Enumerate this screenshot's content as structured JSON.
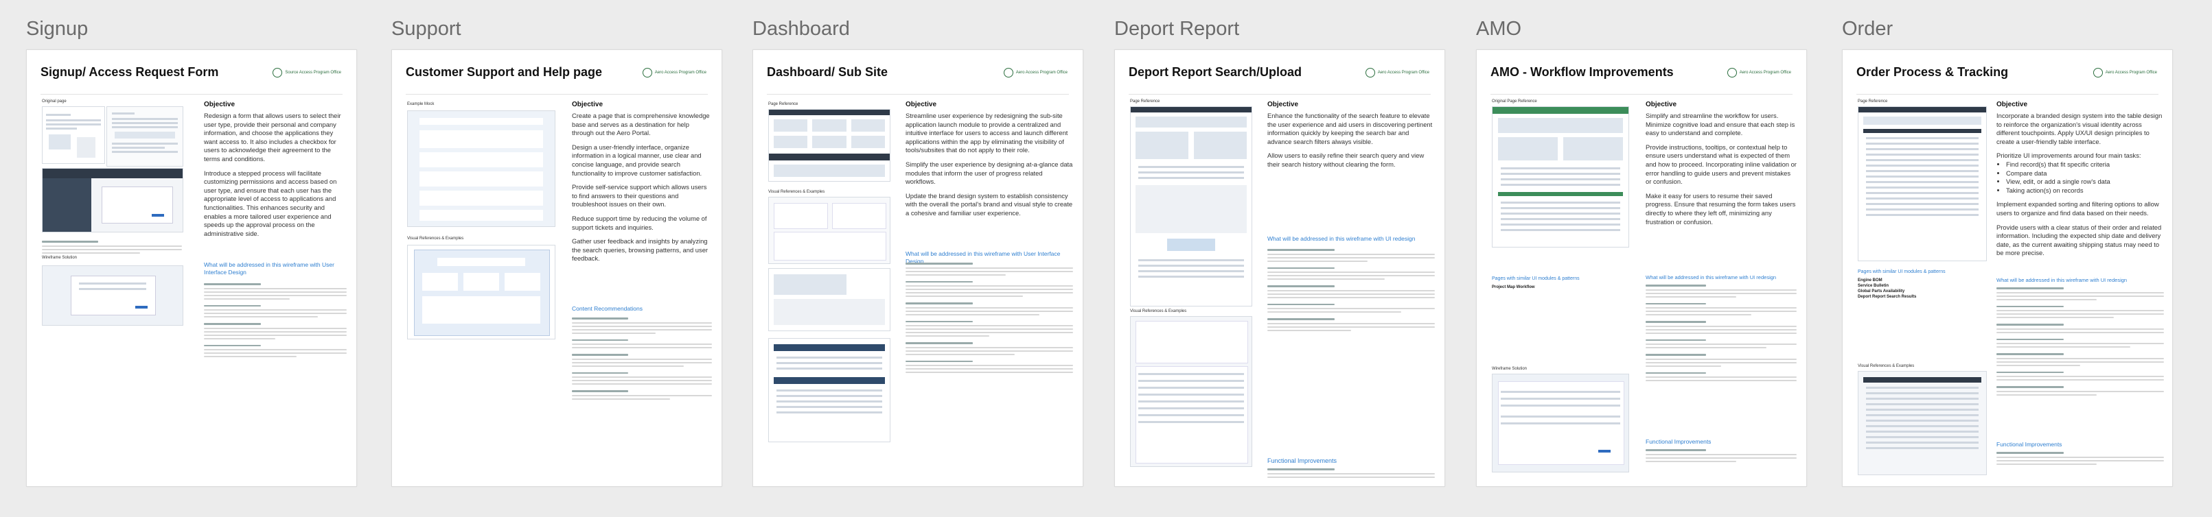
{
  "columns": [
    {
      "label": "Signup",
      "title": "Signup/ Access Request Form",
      "objective_heading": "Objective",
      "objective": [
        "Redesign a form that allows users to select their user type, provide their personal and company information, and choose the applications they want access to. It also includes a checkbox for users to acknowledge their agreement to the terms and conditions.",
        "Introduce a stepped process will facilitate customizing permissions and access based on user type, and ensure that each user has the appropriate level of access to applications and functionalities. This enhances security and enables a more tailored user experience and speeds up the approval process on the administrative side."
      ],
      "addressed_heading": "What will be addressed in this wireframe with User Interface Design",
      "ref_label": "Original page",
      "ref2_label": "Wireframe Solution"
    },
    {
      "label": "Support",
      "title": "Customer Support and Help page",
      "objective_heading": "Objective",
      "objective": [
        "Create a page that is comprehensive knowledge base and serves as a destination for help through out the Aero Portal.",
        "Design a user-friendly interface, organize information in a logical manner, use clear and concise language, and provide search functionality to improve customer satisfaction.",
        "Provide self-service support which allows users to find answers to their questions and troubleshoot issues on their own.",
        "Reduce support time by reducing the volume of support tickets and inquiries.",
        "Gather user feedback and insights by analyzing the search queries, browsing patterns, and user feedback."
      ],
      "addressed_heading": "Content Recommendations",
      "ref_label": "Example Mock",
      "ref2_label": "Visual References & Examples"
    },
    {
      "label": "Dashboard",
      "title": "Dashboard/ Sub Site",
      "objective_heading": "Objective",
      "objective": [
        "Streamline user experience by redesigning the sub-site application launch module to provide a centralized and intuitive interface for users to access and launch different applications within the app by eliminating the visibility of tools/subsites that do not apply to their role.",
        "Simplify the user experience by designing at-a-glance data modules that inform the user of progress related workflows.",
        "Update the brand design system to establish consistency with the overall the portal's brand and visual style to create a cohesive and familiar user experience."
      ],
      "addressed_heading": "What will be addressed in this wireframe with User Interface Design",
      "ref_label": "Page Reference",
      "ref2_label": "Visual References & Examples"
    },
    {
      "label": "Deport Report",
      "title": "Deport Report Search/Upload",
      "objective_heading": "Objective",
      "objective": [
        "Enhance the functionality of the search feature to elevate the user experience and aid users in discovering pertinent information quickly by keeping the search bar and advance search filters always visible.",
        "Allow users to easily refine their search query and view their search history without clearing the form."
      ],
      "addressed_heading": "What will be addressed in this wireframe with UI redesign",
      "extra_heading": "Functional Improvements",
      "ref_label": "Page Reference",
      "ref2_label": "Visual References & Examples"
    },
    {
      "label": "AMO",
      "title": "AMO - Workflow Improvements",
      "objective_heading": "Objective",
      "objective": [
        "Simplify and streamline the workflow for users. Minimize cognitive load and ensure that each step is easy to understand and complete.",
        "Provide instructions, tooltips, or contextual help to ensure users understand what is expected of them and how to proceed. Incorporating inline validation or error handling to guide users and prevent mistakes or confusion.",
        "Make it easy for users to resume their saved progress. Ensure that resuming the form takes users directly to where they left off, minimizing any frustration or confusion."
      ],
      "pages_heading": "Pages with similar UI modules & patterns",
      "pages": [
        "Project Map Workflow"
      ],
      "addressed_heading": "What will be addressed in this wireframe with UI redesign",
      "extra_heading": "Functional Improvements",
      "ref_label": "Original Page Reference",
      "ref2_label": "Wireframe Solution"
    },
    {
      "label": "Order",
      "title": "Order Process & Tracking",
      "objective_heading": "Objective",
      "objective_intro": "Incorporate a branded design system into the table design to reinforce the organization's visual identity across different touchpoints. Apply UX/UI design principles to create a user-friendly table interface.",
      "objective_list_intro": "Prioritize UI improvements around four main tasks:",
      "objective_list": [
        "Find record(s) that fit specific criteria",
        "Compare data",
        "View, edit, or add a single row's data",
        "Taking action(s) on records"
      ],
      "objective": [
        "Implement expanded sorting and filtering options to allow users to organize and find data based on their needs.",
        "Provide users with a clear status of their order and related information. Including the expected ship date and delivery date, as the current awaiting shipping status may need to be more precise."
      ],
      "pages_heading": "Pages with similar UI modules & patterns",
      "pages": [
        "Engine BOM",
        "Service Bulletin",
        "Global Parts Availability",
        "Deport Report Search Results"
      ],
      "addressed_heading": "What will be addressed in this wireframe with UI redesign",
      "extra_heading": "Functional Improvements",
      "ref_label": "Page Reference",
      "ref2_label": "Visual References & Examples"
    }
  ],
  "colors": {
    "accent_link": "#2f7fd0",
    "brand_green": "#2b6e3e",
    "label_gray": "#6a6a6a"
  }
}
